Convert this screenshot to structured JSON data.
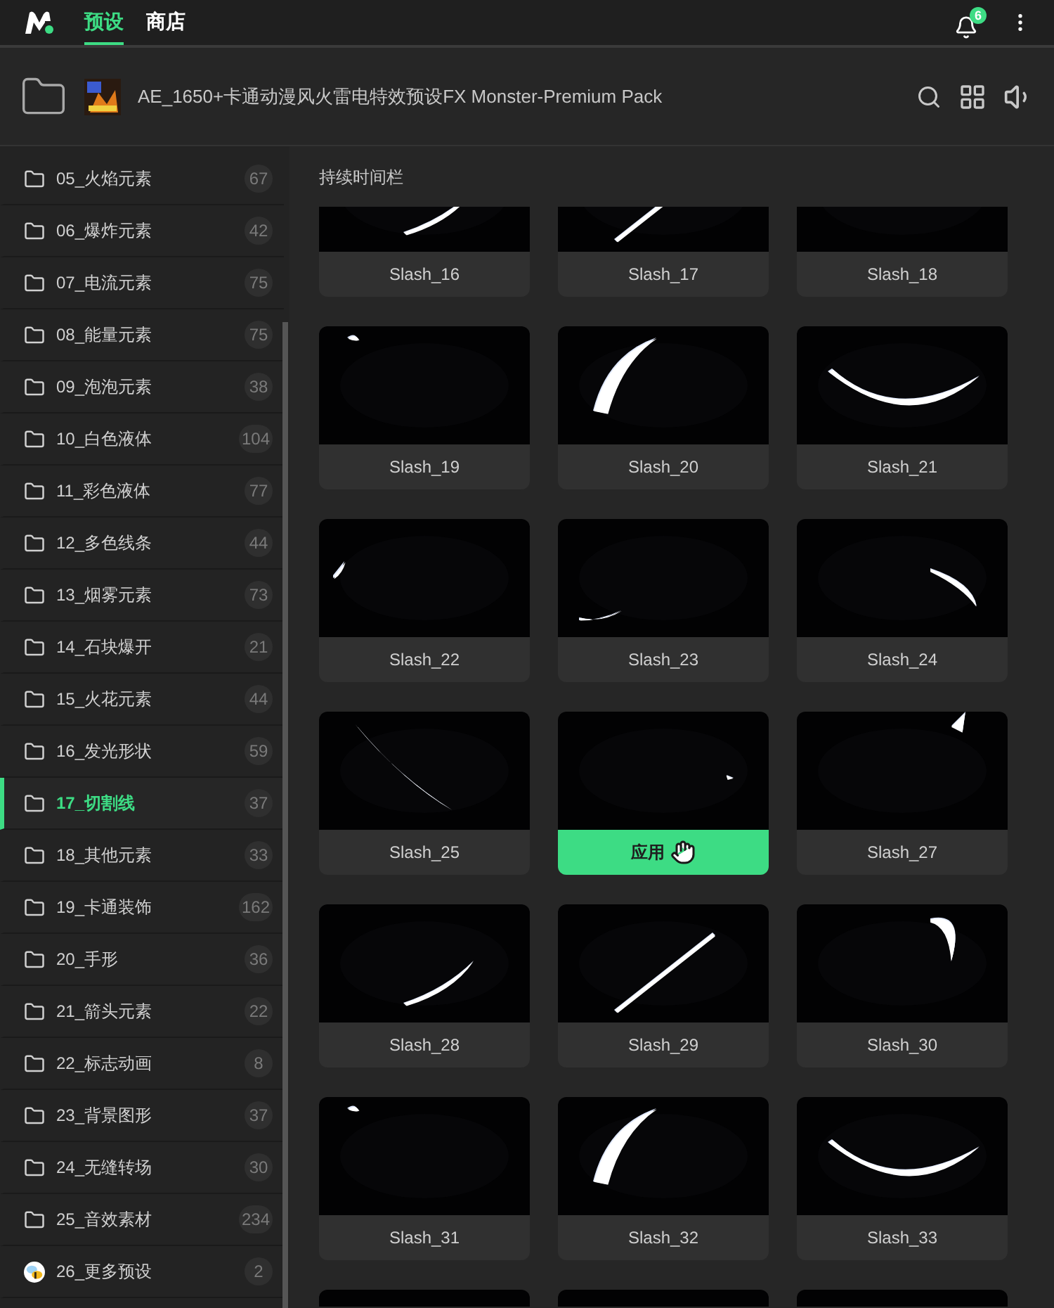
{
  "top_bar": {
    "tabs": [
      {
        "label": "预设",
        "selected": true
      },
      {
        "label": "商店",
        "selected": false
      }
    ],
    "notification_count": "6"
  },
  "pack": {
    "title": "AE_1650+卡通动漫风火雷电特效预设FX Monster-Premium Pack"
  },
  "sidebar": {
    "items": [
      {
        "kind": "folder",
        "label": "05_火焰元素",
        "count": "67",
        "selected": false
      },
      {
        "kind": "folder",
        "label": "06_爆炸元素",
        "count": "42",
        "selected": false
      },
      {
        "kind": "folder",
        "label": "07_电流元素",
        "count": "75",
        "selected": false
      },
      {
        "kind": "folder",
        "label": "08_能量元素",
        "count": "75",
        "selected": false
      },
      {
        "kind": "folder",
        "label": "09_泡泡元素",
        "count": "38",
        "selected": false
      },
      {
        "kind": "folder",
        "label": "10_白色液体",
        "count": "104",
        "selected": false
      },
      {
        "kind": "folder",
        "label": "11_彩色液体",
        "count": "77",
        "selected": false
      },
      {
        "kind": "folder",
        "label": "12_多色线条",
        "count": "44",
        "selected": false
      },
      {
        "kind": "folder",
        "label": "13_烟雾元素",
        "count": "73",
        "selected": false
      },
      {
        "kind": "folder",
        "label": "14_石块爆开",
        "count": "21",
        "selected": false
      },
      {
        "kind": "folder",
        "label": "15_火花元素",
        "count": "44",
        "selected": false
      },
      {
        "kind": "folder",
        "label": "16_发光形状",
        "count": "59",
        "selected": false
      },
      {
        "kind": "folder",
        "label": "17_切割线",
        "count": "37",
        "selected": true
      },
      {
        "kind": "folder",
        "label": "18_其他元素",
        "count": "33",
        "selected": false
      },
      {
        "kind": "folder",
        "label": "19_卡通装饰",
        "count": "162",
        "selected": false
      },
      {
        "kind": "folder",
        "label": "20_手形",
        "count": "36",
        "selected": false
      },
      {
        "kind": "folder",
        "label": "21_箭头元素",
        "count": "22",
        "selected": false
      },
      {
        "kind": "folder",
        "label": "22_标志动画",
        "count": "8",
        "selected": false
      },
      {
        "kind": "folder",
        "label": "23_背景图形",
        "count": "37",
        "selected": false
      },
      {
        "kind": "folder",
        "label": "24_无缝转场",
        "count": "30",
        "selected": false
      },
      {
        "kind": "folder",
        "label": "25_音效素材",
        "count": "234",
        "selected": false
      },
      {
        "kind": "mascot",
        "label": "26_更多预设",
        "count": "2",
        "selected": false
      }
    ]
  },
  "section": {
    "title": "持续时间栏"
  },
  "cards": [
    {
      "kind": "preview",
      "label": "Slash_16",
      "hovered": false
    },
    {
      "kind": "preview",
      "label": "Slash_17",
      "hovered": false
    },
    {
      "kind": "preview",
      "label": "Slash_18",
      "hovered": false
    },
    {
      "kind": "preview",
      "label": "Slash_19",
      "hovered": false
    },
    {
      "kind": "preview",
      "label": "Slash_20",
      "hovered": false
    },
    {
      "kind": "preview",
      "label": "Slash_21",
      "hovered": false
    },
    {
      "kind": "preview",
      "label": "Slash_22",
      "hovered": false
    },
    {
      "kind": "preview",
      "label": "Slash_23",
      "hovered": false
    },
    {
      "kind": "preview",
      "label": "Slash_24",
      "hovered": false
    },
    {
      "kind": "preview",
      "label": "Slash_25",
      "hovered": false
    },
    {
      "kind": "preview",
      "action": "应用",
      "hovered": true
    },
    {
      "kind": "preview",
      "label": "Slash_27",
      "hovered": false
    },
    {
      "kind": "preview",
      "label": "Slash_28",
      "hovered": false
    },
    {
      "kind": "preview",
      "label": "Slash_29",
      "hovered": false
    },
    {
      "kind": "preview",
      "label": "Slash_30",
      "hovered": false
    },
    {
      "kind": "preview",
      "label": "Slash_31",
      "hovered": false
    },
    {
      "kind": "preview",
      "label": "Slash_32",
      "hovered": false
    },
    {
      "kind": "preview",
      "label": "Slash_33",
      "hovered": false
    },
    {
      "kind": "picture"
    },
    {
      "kind": "picture"
    },
    {
      "kind": "picture"
    }
  ]
}
